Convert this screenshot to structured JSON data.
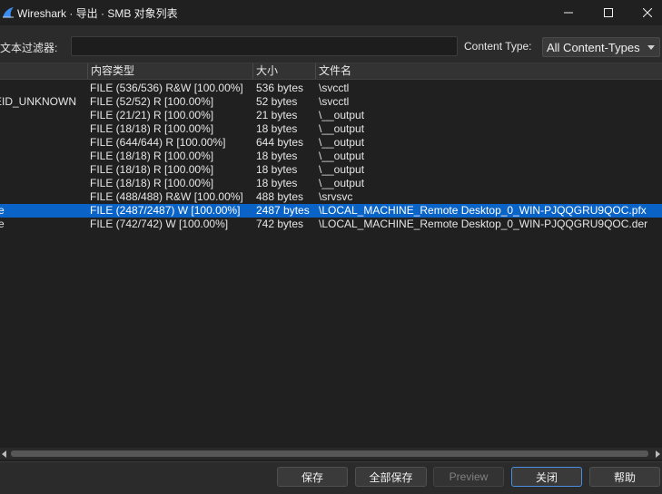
{
  "window": {
    "title": "Wireshark · 导出 · SMB 对象列表",
    "minimize_glyph": "—",
    "maximize_glyph": "☐",
    "close_glyph": "✕"
  },
  "filter": {
    "label": "文本过滤器:",
    "value": "",
    "placeholder": ""
  },
  "content_type": {
    "label": "Content Type:",
    "selected": "All Content-Types"
  },
  "table": {
    "columns": [
      "",
      "内容类型",
      "大小",
      "文件名"
    ],
    "rows": [
      {
        "c0": "s",
        "type": "FILE (536/536) R&W [100.00%]",
        "size": "536 bytes",
        "name": "\\svcctl"
      },
      {
        "c0": "EID_UNKNOWN",
        "type": "FILE (52/52) R [100.00%]",
        "size": "52 bytes",
        "name": "\\svcctl"
      },
      {
        "c0": "",
        "type": "FILE (21/21) R [100.00%]",
        "size": "21 bytes",
        "name": "\\__output"
      },
      {
        "c0": "",
        "type": "FILE (18/18) R [100.00%]",
        "size": "18 bytes",
        "name": "\\__output"
      },
      {
        "c0": "",
        "type": "FILE (644/644) R [100.00%]",
        "size": "644 bytes",
        "name": "\\__output"
      },
      {
        "c0": "",
        "type": "FILE (18/18) R [100.00%]",
        "size": "18 bytes",
        "name": "\\__output"
      },
      {
        "c0": "",
        "type": "FILE (18/18) R [100.00%]",
        "size": "18 bytes",
        "name": "\\__output"
      },
      {
        "c0": "",
        "type": "FILE (18/18) R [100.00%]",
        "size": "18 bytes",
        "name": "\\__output"
      },
      {
        "c0": "s",
        "type": "FILE (488/488) R&W [100.00%]",
        "size": "488 bytes",
        "name": "\\srvsvc"
      },
      {
        "c0": "re",
        "type": "FILE (2487/2487) W [100.00%]",
        "size": "2487 bytes",
        "name": "\\LOCAL_MACHINE_Remote Desktop_0_WIN-PJQQGRU9QOC.pfx",
        "selected": true
      },
      {
        "c0": "re",
        "type": "FILE (742/742) W [100.00%]",
        "size": "742 bytes",
        "name": "\\LOCAL_MACHINE_Remote Desktop_0_WIN-PJQQGRU9QOC.der"
      }
    ]
  },
  "buttons": {
    "save": "保存",
    "save_all": "全部保存",
    "preview": "Preview",
    "close": "关闭",
    "help": "帮助"
  },
  "colors": {
    "selection": "#0a64c8",
    "background": "#2b2b2b",
    "titlebar": "#202020"
  }
}
